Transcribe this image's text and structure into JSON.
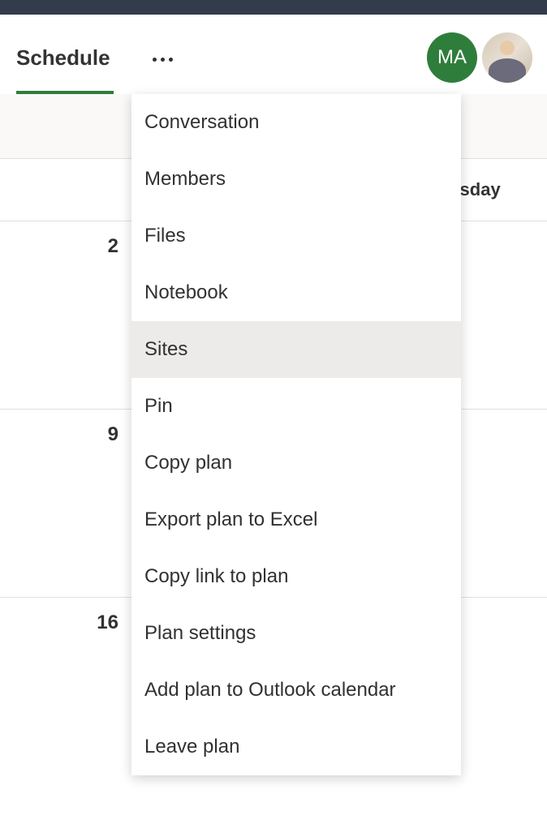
{
  "header": {
    "tab_label": "Schedule"
  },
  "avatars": {
    "initials": "MA"
  },
  "calendar": {
    "day_header": "rsday",
    "week1_date": "2",
    "week2_date": "9",
    "week3_date": "16"
  },
  "menu": {
    "items": [
      {
        "label": "Conversation",
        "hover": false
      },
      {
        "label": "Members",
        "hover": false
      },
      {
        "label": "Files",
        "hover": false
      },
      {
        "label": "Notebook",
        "hover": false
      },
      {
        "label": "Sites",
        "hover": true
      },
      {
        "label": "Pin",
        "hover": false
      },
      {
        "label": "Copy plan",
        "hover": false
      },
      {
        "label": "Export plan to Excel",
        "hover": false
      },
      {
        "label": "Copy link to plan",
        "hover": false
      },
      {
        "label": "Plan settings",
        "hover": false
      },
      {
        "label": "Add plan to Outlook calendar",
        "hover": false
      },
      {
        "label": "Leave plan",
        "hover": false
      }
    ]
  }
}
